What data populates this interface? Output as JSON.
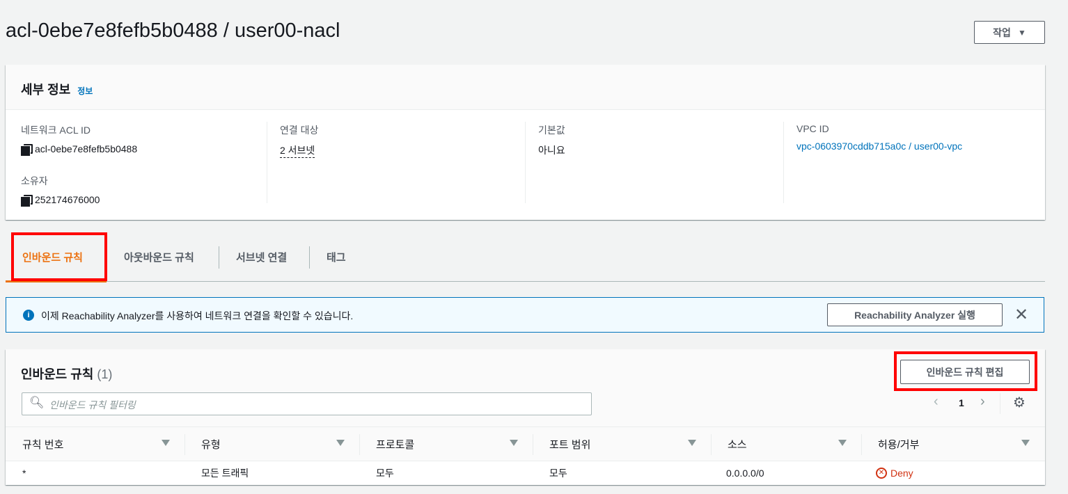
{
  "header": {
    "title": "acl-0ebe7e8fefb5b0488 / user00-nacl",
    "actions_label": "작업"
  },
  "details": {
    "title": "세부 정보",
    "info_link": "정보",
    "fields": {
      "acl_id_label": "네트워크 ACL ID",
      "acl_id": "acl-0ebe7e8fefb5b0488",
      "owner_label": "소유자",
      "owner": "252174676000",
      "assoc_label": "연결 대상",
      "assoc": "2 서브넷",
      "default_label": "기본값",
      "default": "아니요",
      "vpc_label": "VPC ID",
      "vpc": "vpc-0603970cddb715a0c / user00-vpc"
    }
  },
  "tabs": [
    {
      "label": "인바운드 규칙",
      "active": true
    },
    {
      "label": "아웃바운드 규칙"
    },
    {
      "label": "서브넷 연결"
    },
    {
      "label": "태그"
    }
  ],
  "banner": {
    "text": "이제 Reachability Analyzer를 사용하여 네트워크 연결을 확인할 수 있습니다.",
    "button": "Reachability Analyzer 실행"
  },
  "rules": {
    "title": "인바운드 규칙",
    "count": "(1)",
    "edit_button": "인바운드 규칙 편집",
    "filter_placeholder": "인바운드 규칙 필터링",
    "page": "1",
    "columns": [
      "규칙 번호",
      "유형",
      "프로토콜",
      "포트 범위",
      "소스",
      "허용/거부"
    ],
    "rows": [
      [
        "*",
        "모든 트래픽",
        "모두",
        "모두",
        "0.0.0.0/0",
        "Deny"
      ]
    ]
  },
  "colors": {
    "accent": "#ec7211",
    "link": "#0073bb",
    "deny": "#d13212",
    "highlight": "#ff0000"
  }
}
